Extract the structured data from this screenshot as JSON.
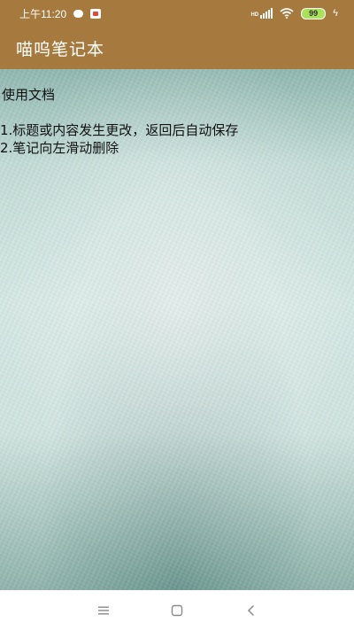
{
  "status_bar": {
    "time": "上午11:20",
    "battery_level": "99",
    "icons": [
      "chat-bubble-icon",
      "screen-record-icon",
      "hd-signal-icon",
      "wifi-icon",
      "battery-icon",
      "charging-bolt-icon"
    ],
    "signal_badge": "HD"
  },
  "app_bar": {
    "title": "喵呜笔记本",
    "color": "#a67a3e"
  },
  "note": {
    "title": "使用文档",
    "lines": [
      "1.标题或内容发生更改，返回后自动保存",
      "2.笔记向左滑动删除"
    ]
  },
  "nav_bar": {
    "buttons": [
      "menu-icon",
      "home-icon",
      "back-icon"
    ]
  }
}
